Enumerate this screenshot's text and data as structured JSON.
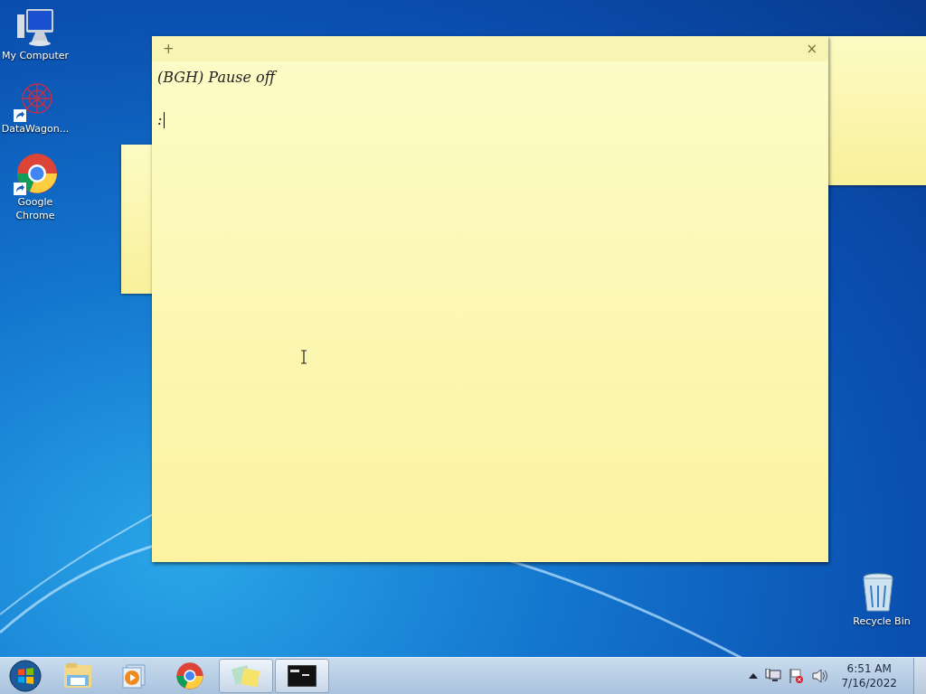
{
  "desktop_icons": [
    {
      "kind": "computer",
      "label": "My Computer",
      "shortcut": false
    },
    {
      "kind": "datawagon",
      "label": "DataWagon...",
      "shortcut": true
    },
    {
      "kind": "chrome",
      "label": "Google Chrome",
      "shortcut": true
    },
    {
      "kind": "recycle",
      "label": "Recycle Bin",
      "shortcut": false
    }
  ],
  "sticky_note": {
    "new_button": "+",
    "close_button": "×",
    "lines": [
      "(BGH) Pause off",
      ":"
    ]
  },
  "taskbar": {
    "items": [
      {
        "kind": "explorer",
        "selected": false
      },
      {
        "kind": "media",
        "selected": false
      },
      {
        "kind": "chrome",
        "selected": false
      },
      {
        "kind": "notes",
        "selected": true
      },
      {
        "kind": "cmd",
        "selected": true
      }
    ],
    "time": "6:51 AM",
    "date": "7/16/2022"
  }
}
